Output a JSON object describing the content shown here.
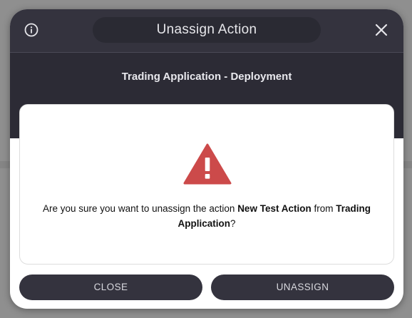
{
  "dialog": {
    "title": "Unassign Action",
    "subtitle": "Trading Application - Deployment",
    "info_icon": "info-circle-icon",
    "close_icon": "close-icon",
    "warning_icon": "warning-triangle-icon",
    "message": {
      "part1": "Are you sure you want to unassign the action ",
      "action_name": "New Test Action",
      "part2": " from ",
      "target_name": "Trading Application",
      "part3": "?"
    },
    "buttons": {
      "close_label": "CLOSE",
      "unassign_label": "UNASSIGN"
    }
  },
  "colors": {
    "header_bg": "#34333e",
    "subheader_bg": "#2c2b35",
    "button_bg": "#34333e",
    "warning": "#cc4a4a",
    "backdrop": "#8f8f8f"
  }
}
